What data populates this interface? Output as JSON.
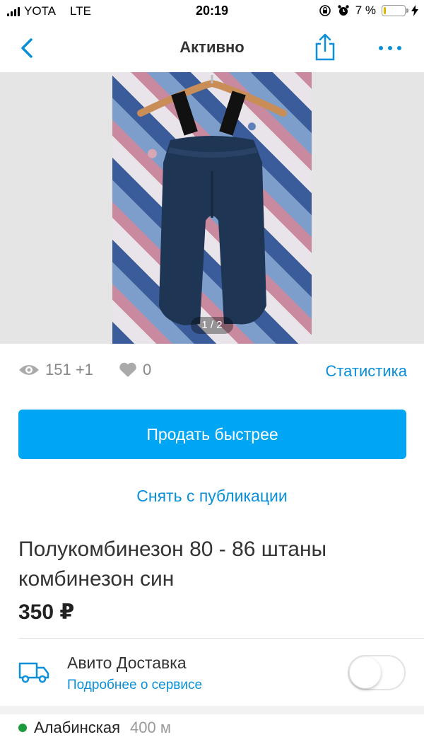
{
  "status_bar": {
    "carrier": "YOTA",
    "network": "LTE",
    "time": "20:19",
    "battery": "7 %"
  },
  "nav": {
    "title": "Активно",
    "icons": {
      "back": "chevron-left-icon",
      "share": "share-icon",
      "more": "more-dots-icon"
    }
  },
  "gallery": {
    "counter": "1 / 2"
  },
  "stats": {
    "views": "151 +1",
    "favorites": "0",
    "statistics_link": "Статистика"
  },
  "actions": {
    "sell_faster": "Продать быстрее",
    "unpublish": "Снять с публикации"
  },
  "item": {
    "title": "Полукомбинезон 80 - 86 штаны комбинезон син",
    "price": "350 ₽"
  },
  "delivery": {
    "title": "Авито Доставка",
    "link": "Подробнее о сервисе",
    "enabled": false
  },
  "location": {
    "metro": "Алабинская",
    "distance": "400 м",
    "metro_color": "#1a9a3a"
  },
  "colors": {
    "accent": "#0a8fd8",
    "primary_button": "#00a6f3"
  }
}
